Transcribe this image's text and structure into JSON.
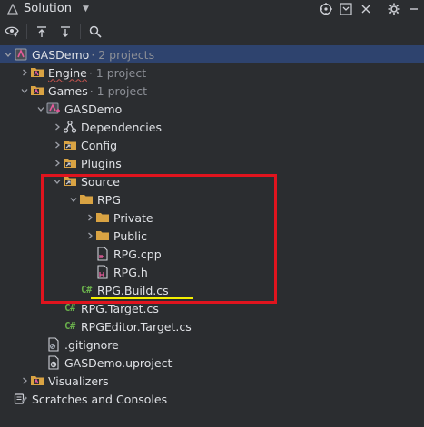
{
  "header": {
    "title": "Solution",
    "icons": [
      "target-icon",
      "collapse-all-icon",
      "close-icon",
      "settings-icon",
      "minimize-icon"
    ]
  },
  "toolbar": {
    "icons": [
      "eye-filter-icon",
      "expand-up-icon",
      "expand-down-icon",
      "search-icon"
    ]
  },
  "tree": [
    {
      "label": "GASDemo",
      "meta": "· 2 projects",
      "icon": "solution-icon",
      "level": 0,
      "arrow": "down",
      "selected": true
    },
    {
      "label": "Engine",
      "meta": "· 1 project",
      "icon": "folder-project-icon",
      "level": 1,
      "arrow": "right",
      "underline": true
    },
    {
      "label": "Games",
      "meta": "· 1 project",
      "icon": "folder-project-icon",
      "level": 1,
      "arrow": "down"
    },
    {
      "label": "GASDemo",
      "meta": "",
      "icon": "project-icon",
      "level": 2,
      "arrow": "down"
    },
    {
      "label": "Dependencies",
      "meta": "",
      "icon": "dependencies-icon",
      "level": 3,
      "arrow": "right"
    },
    {
      "label": "Config",
      "meta": "",
      "icon": "folder-link-icon",
      "level": 3,
      "arrow": "right"
    },
    {
      "label": "Plugins",
      "meta": "",
      "icon": "folder-link-icon",
      "level": 3,
      "arrow": "right"
    },
    {
      "label": "Source",
      "meta": "",
      "icon": "folder-link-icon",
      "level": 3,
      "arrow": "down"
    },
    {
      "label": "RPG",
      "meta": "",
      "icon": "folder-icon",
      "level": 4,
      "arrow": "down"
    },
    {
      "label": "Private",
      "meta": "",
      "icon": "folder-icon",
      "level": 5,
      "arrow": "right"
    },
    {
      "label": "Public",
      "meta": "",
      "icon": "folder-icon",
      "level": 5,
      "arrow": "right"
    },
    {
      "label": "RPG.cpp",
      "meta": "",
      "icon": "cpp-file-icon",
      "level": 5,
      "arrow": "none"
    },
    {
      "label": "RPG.h",
      "meta": "",
      "icon": "header-file-icon",
      "level": 5,
      "arrow": "none"
    },
    {
      "label": "RPG.Build.cs",
      "meta": "",
      "icon": "csharp-file-icon",
      "level": 4,
      "arrow": "none"
    },
    {
      "label": "RPG.Target.cs",
      "meta": "",
      "icon": "csharp-file-icon",
      "level": 3,
      "arrow": "none"
    },
    {
      "label": "RPGEditor.Target.cs",
      "meta": "",
      "icon": "csharp-file-icon",
      "level": 3,
      "arrow": "none"
    },
    {
      "label": ".gitignore",
      "meta": "",
      "icon": "gitignore-file-icon",
      "level": 2,
      "arrow": "none"
    },
    {
      "label": "GASDemo.uproject",
      "meta": "",
      "icon": "uproject-file-icon",
      "level": 2,
      "arrow": "none"
    },
    {
      "label": "Visualizers",
      "meta": "",
      "icon": "folder-project-icon",
      "level": 1,
      "arrow": "right"
    },
    {
      "label": "Scratches and Consoles",
      "meta": "",
      "icon": "scratches-icon",
      "level": 0,
      "arrow": "none"
    }
  ],
  "colors": {
    "background": "#2b2d30",
    "selection": "#2e436e",
    "highlight_box": "#e0141e",
    "underline": "#f4f000",
    "folder": "#d9a343",
    "csharp": "#6ab04c"
  }
}
